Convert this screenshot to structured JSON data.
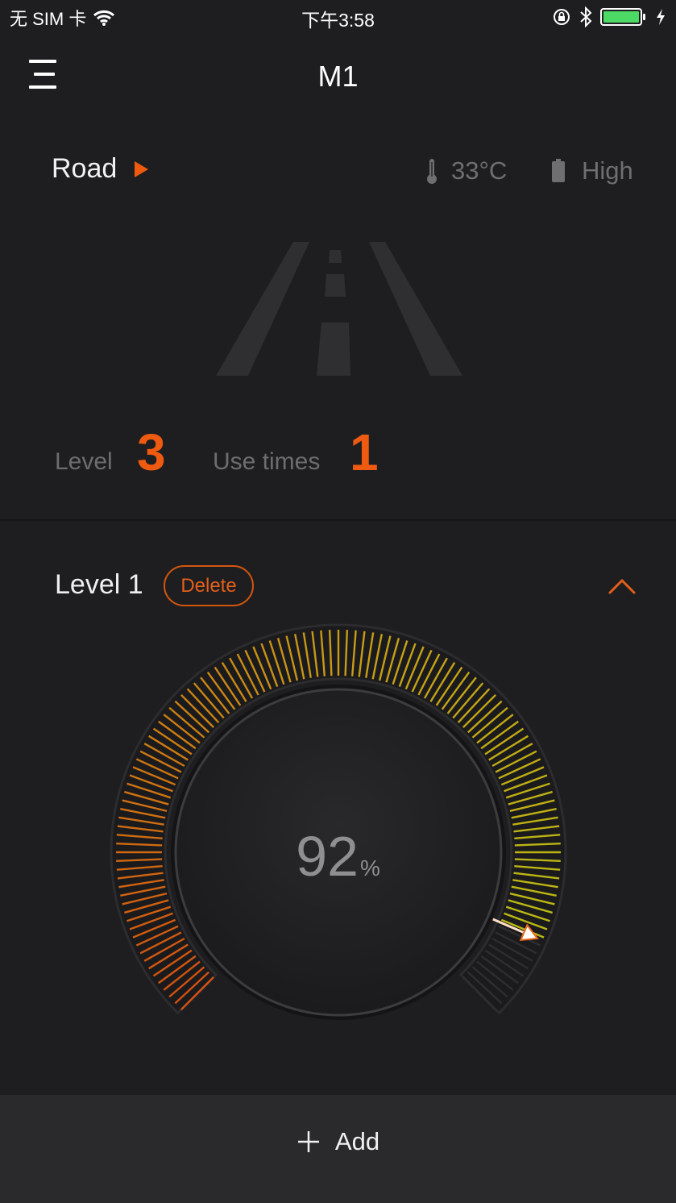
{
  "status_bar": {
    "carrier": "无 SIM 卡",
    "time": "下午3:58",
    "battery_color": "#4cd964"
  },
  "nav": {
    "title": "M1",
    "menu_icon": "menu-icon"
  },
  "mode": {
    "label": "Road",
    "icon": "play-icon",
    "accent": "#ee5a10"
  },
  "sensors": {
    "temperature": "33°C",
    "temperature_icon": "thermometer-icon",
    "battery": "High",
    "battery_icon": "battery-icon"
  },
  "stats": {
    "level_label": "Level",
    "level_value": "3",
    "use_times_label": "Use times",
    "use_times_value": "1"
  },
  "level_section": {
    "title": "Level 1",
    "delete_label": "Delete",
    "collapse_icon": "chevron-up-icon"
  },
  "dial": {
    "value": "92",
    "unit": "%",
    "level_fraction": 0.92
  },
  "bottom": {
    "add_label": "Add",
    "add_icon": "plus-icon"
  }
}
